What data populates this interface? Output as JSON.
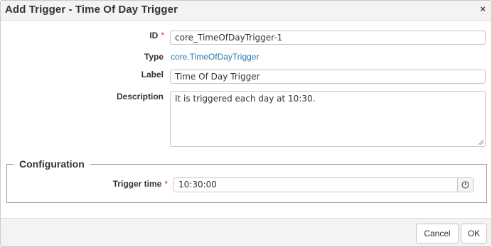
{
  "dialog": {
    "title": "Add Trigger - Time Of Day Trigger",
    "close_glyph": "×",
    "close_icon": "close-icon"
  },
  "fields": {
    "id": {
      "label": "ID",
      "required_mark": "*",
      "value": "core_TimeOfDayTrigger-1"
    },
    "type": {
      "label": "Type",
      "value": "core.TimeOfDayTrigger"
    },
    "label": {
      "label": "Label",
      "value": "Time Of Day Trigger"
    },
    "description": {
      "label": "Description",
      "value": "It is triggered each day at 10:30."
    }
  },
  "configuration": {
    "legend": "Configuration",
    "trigger_time": {
      "label": "Trigger time",
      "required_mark": "*",
      "value": "10:30:00",
      "icon": "clock-icon"
    }
  },
  "footer": {
    "cancel_label": "Cancel",
    "ok_label": "OK"
  },
  "colors": {
    "required": "#d9342b",
    "link": "#2a7ab0",
    "header_bg": "#f3f3f3"
  }
}
